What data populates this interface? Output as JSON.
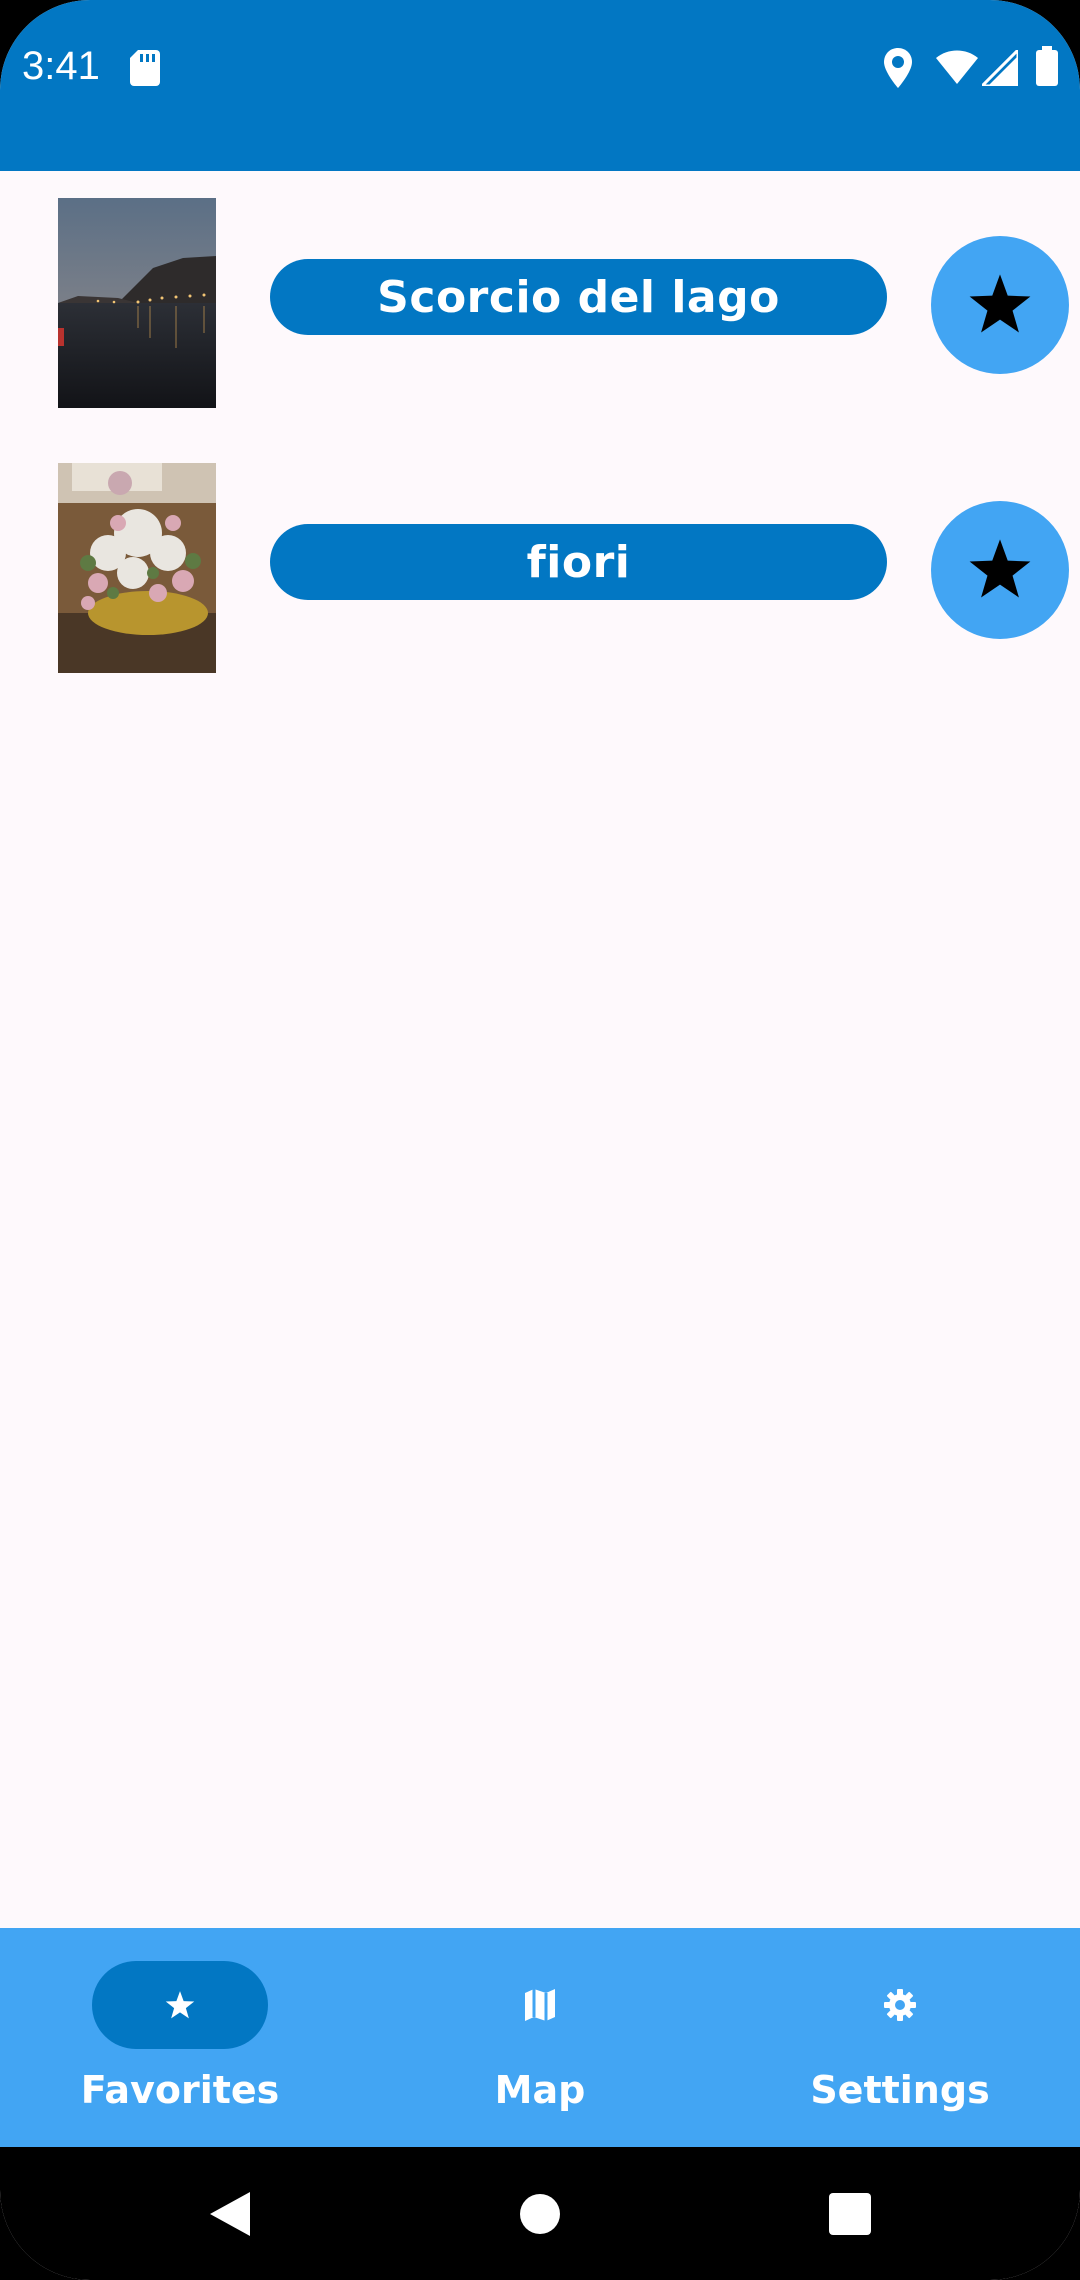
{
  "status_bar": {
    "time": "3:41",
    "icons": [
      "sd-card-icon",
      "location-icon",
      "wifi-icon",
      "signal-icon",
      "battery-icon"
    ]
  },
  "colors": {
    "primary": "#0277C3",
    "secondary": "#42A5F3",
    "background": "#FEF9FC",
    "on_primary": "#FFFFFF"
  },
  "favorites": [
    {
      "title": "Scorcio del lago",
      "image": "lake-night-photo",
      "favorited": true
    },
    {
      "title": "fiori",
      "image": "flowers-photo",
      "favorited": true
    }
  ],
  "bottom_nav": {
    "selected": "Favorites",
    "items": [
      {
        "label": "Favorites",
        "icon": "star-icon"
      },
      {
        "label": "Map",
        "icon": "map-icon"
      },
      {
        "label": "Settings",
        "icon": "gear-icon"
      }
    ]
  },
  "system_nav": [
    "back-icon",
    "home-icon",
    "recents-icon"
  ]
}
